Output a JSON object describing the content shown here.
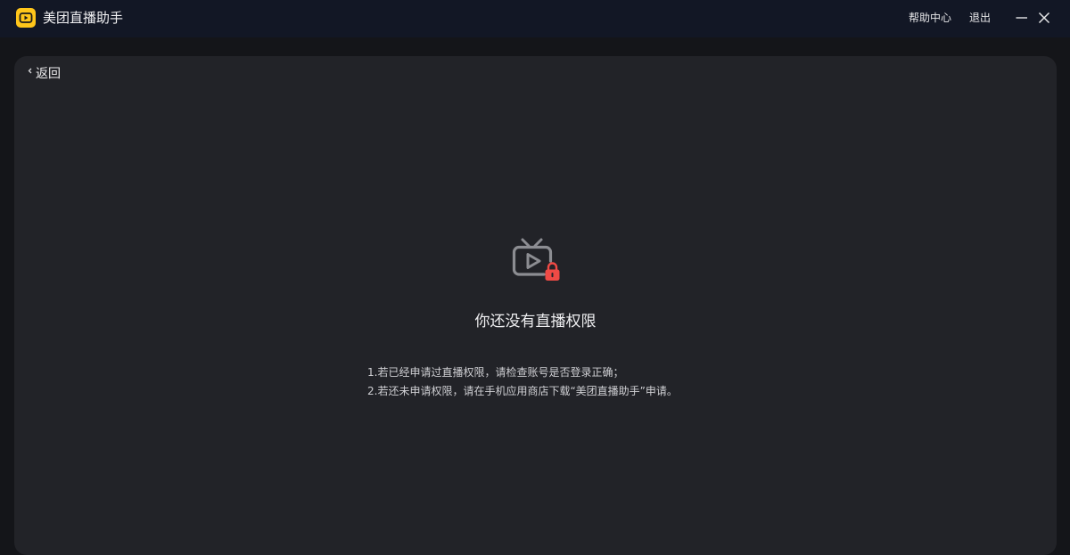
{
  "titlebar": {
    "app_title": "美团直播助手",
    "help_label": "帮助中心",
    "logout_label": "退出",
    "logo_color": "#ffc61a",
    "background": "#121725"
  },
  "icons": {
    "logo": "tv-play-logo-icon",
    "minimize": "minimize-icon",
    "close": "close-icon",
    "back": "chevron-left-icon",
    "empty_state": "tv-play-lock-icon"
  },
  "panel": {
    "back_label": "返回",
    "background": "#222328"
  },
  "empty_state": {
    "title": "你还没有直播权限",
    "tips": [
      "1.若已经申请过直播权限，请检查账号是否登录正确；",
      "2.若还未申请权限，请在手机应用商店下载“美团直播助手”申请。"
    ],
    "lock_color": "#f04a45",
    "icon_color": "#8c8d92"
  }
}
